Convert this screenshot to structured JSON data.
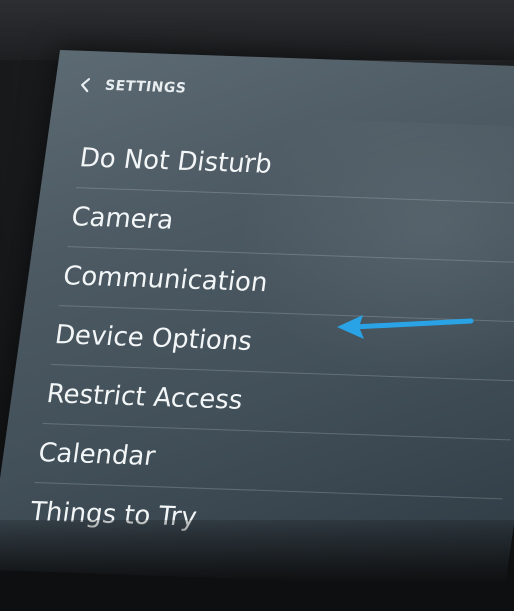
{
  "header": {
    "title": "SETTINGS",
    "back_icon": "chevron-left-icon"
  },
  "menu": {
    "items": [
      {
        "label": "Do Not Disturb"
      },
      {
        "label": "Camera"
      },
      {
        "label": "Communication"
      },
      {
        "label": "Device Options"
      },
      {
        "label": "Restrict Access"
      },
      {
        "label": "Calendar"
      },
      {
        "label": "Things to Try"
      }
    ]
  },
  "annotation": {
    "arrow_color": "#2aa3e6",
    "arrow_icon": "left-arrow-icon",
    "points_to": "Device Options"
  }
}
